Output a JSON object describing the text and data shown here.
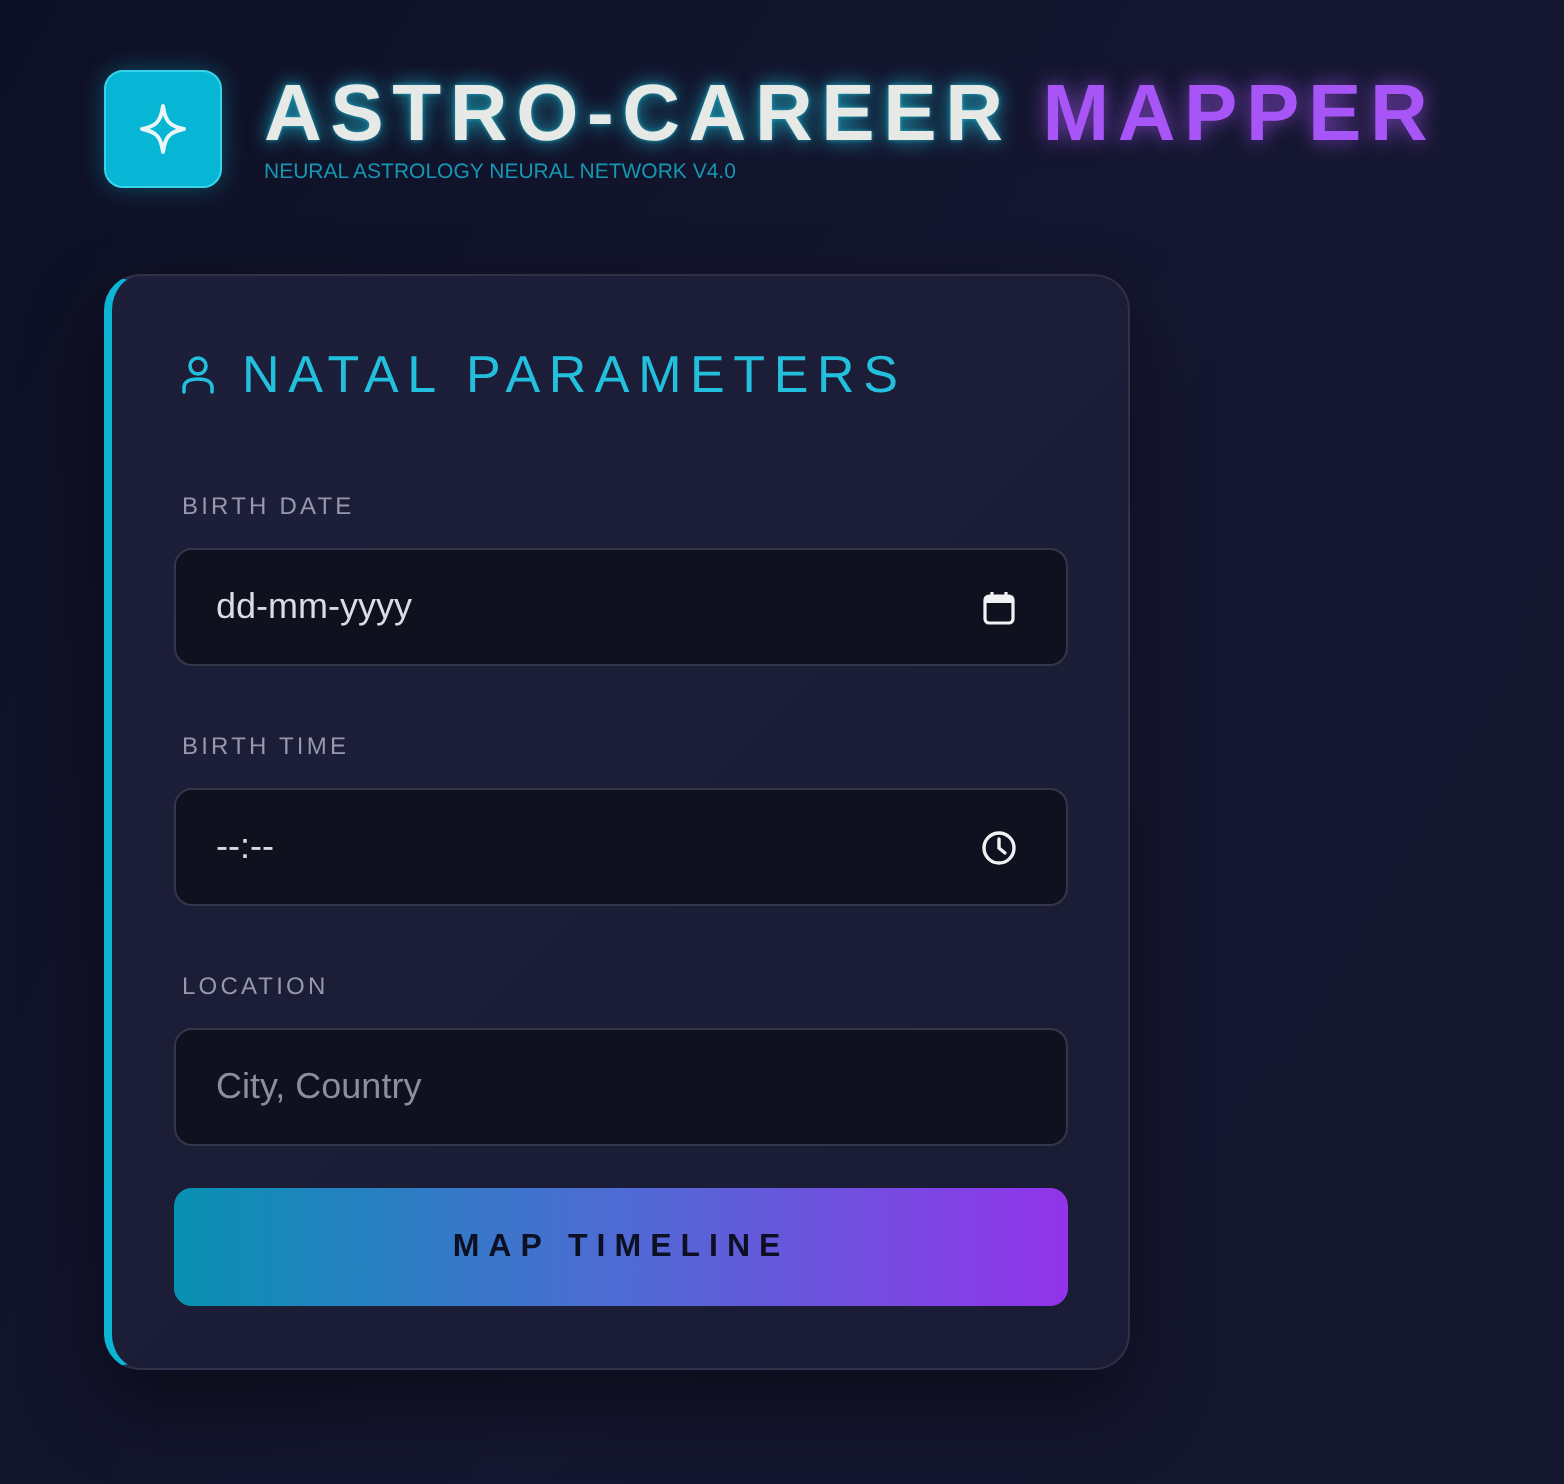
{
  "header": {
    "title": "ASTRO-CAREER",
    "title_accent": "MAPPER",
    "subtitle": "NEURAL ASTROLOGY NEURAL NETWORK V4.0"
  },
  "form": {
    "title": "NATAL PARAMETERS",
    "fields": [
      {
        "kind": "date",
        "label": "BIRTH DATE",
        "placeholder": "dd-mm-yyyy"
      },
      {
        "kind": "time",
        "label": "BIRTH TIME",
        "placeholder": "--:--"
      },
      {
        "kind": "text",
        "label": "LOCATION",
        "placeholder": "City, Country"
      }
    ],
    "submit": "MAP TIMELINE"
  }
}
